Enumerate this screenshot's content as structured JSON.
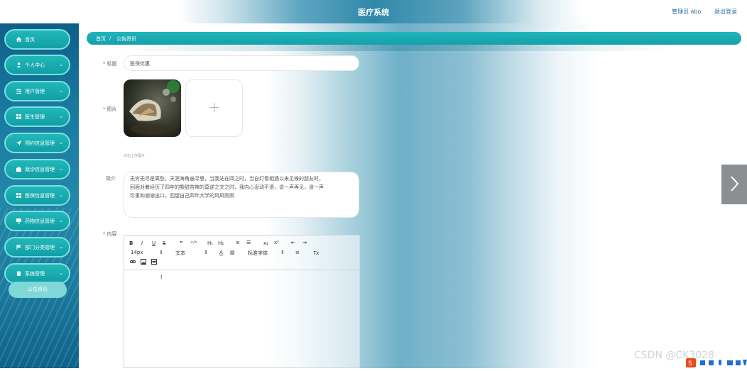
{
  "header": {
    "title": "医疗系统",
    "user": "管理员 abo",
    "logout": "退出登录"
  },
  "sidebar": {
    "items": [
      {
        "label": "首页",
        "icon": "home-icon",
        "chevron": false
      },
      {
        "label": "个人中心",
        "icon": "user-icon",
        "chevron": true
      },
      {
        "label": "用户管理",
        "icon": "sliders-icon",
        "chevron": true
      },
      {
        "label": "医生管理",
        "icon": "grid-icon",
        "chevron": true
      },
      {
        "label": "预约信息管理",
        "icon": "send-icon",
        "chevron": true
      },
      {
        "label": "就诊信息管理",
        "icon": "briefcase-icon",
        "chevron": true
      },
      {
        "label": "医保信息管理",
        "icon": "grid-icon",
        "chevron": true
      },
      {
        "label": "药物信息管理",
        "icon": "monitor-icon",
        "chevron": true
      },
      {
        "label": "部门分类管理",
        "icon": "flag-icon",
        "chevron": true
      },
      {
        "label": "系统管理",
        "icon": "trash-icon",
        "chevron": true
      }
    ],
    "sub_item": "公告资讯"
  },
  "breadcrumb": {
    "home": "首页",
    "sep": "/",
    "current": "公告资讯"
  },
  "form": {
    "title_label": "标题",
    "title_value": "医保优惠",
    "image_label": "图片",
    "upload_hint": "点击上传图片",
    "upload_plus": "+",
    "intro_label": "简介",
    "intro_lines": [
      "无穷无尽是离愁，天涯海角遍寻思，当我站在四之时，当自灯看相遇以来见候的朋友时，",
      "回面对着经历了四年的酸甜苦辣的莫逆之交之时，我内心澎动不语，说一声再见，道一声",
      "珍重和谢谢出口，回望自己四年大学的风风雨雨"
    ],
    "content_label": "内容"
  },
  "editor": {
    "row1": [
      "B",
      "I",
      "U",
      "S",
      "”",
      "</>",
      "H₁",
      "H₂",
      "≡",
      "☰",
      "x₂",
      "x²",
      "⇤",
      "⇥"
    ],
    "font_size": "14px",
    "text_type": "文本",
    "font_family": "标准字体",
    "row2_extra": [
      "A",
      "▨",
      "≡",
      "Tx"
    ],
    "row3": [
      "link",
      "image",
      "video"
    ]
  },
  "watermark": "CSDN @CK3028",
  "colors": {
    "accent": "#17a6ad",
    "sidebar": "#197aa0"
  }
}
